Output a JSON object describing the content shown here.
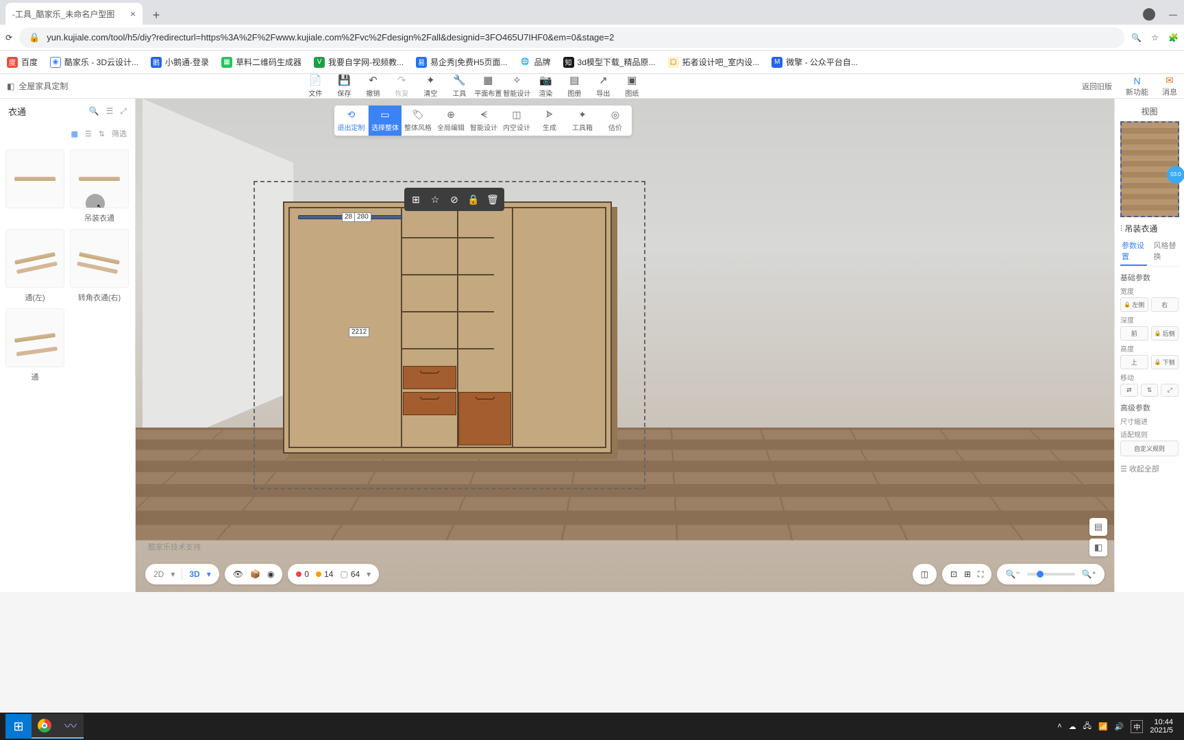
{
  "browser": {
    "tab_title": "-工具_酷家乐_未命名户型图",
    "url_display": "yun.kujiale.com/tool/h5/diy?redirecturl=https%3A%2F%2Fwww.kujiale.com%2Fvc%2Fdesign%2Fall&designid=3FO465U7IHF0&em=0&stage=2"
  },
  "bookmarks": [
    "百度",
    "酷家乐 - 3D云设计...",
    "小鹅通-登录",
    "草料二维码生成器",
    "我要自学网-视频教...",
    "易企秀|免费H5页面...",
    "品牌",
    "3d模型下载_精品原...",
    "拓者设计吧_室内设...",
    "微擎 - 公众平台自..."
  ],
  "app": {
    "mode_label": "全屋家具定制",
    "toolbar": [
      {
        "name": "file",
        "label": "文件",
        "icon": "📄"
      },
      {
        "name": "save",
        "label": "保存",
        "icon": "💾"
      },
      {
        "name": "undo",
        "label": "撤销",
        "icon": "↶"
      },
      {
        "name": "redo",
        "label": "恢复",
        "icon": "↷",
        "disabled": true
      },
      {
        "name": "clear",
        "label": "清空",
        "icon": "✦"
      },
      {
        "name": "tool",
        "label": "工具",
        "icon": "🔧"
      },
      {
        "name": "plan",
        "label": "平面布置",
        "icon": "▦"
      },
      {
        "name": "smart",
        "label": "智能设计",
        "icon": "✧"
      },
      {
        "name": "render",
        "label": "渲染",
        "icon": "📷"
      },
      {
        "name": "album",
        "label": "图册",
        "icon": "▤"
      },
      {
        "name": "export",
        "label": "导出",
        "icon": "↗"
      },
      {
        "name": "drawing",
        "label": "图纸",
        "icon": "▣"
      }
    ],
    "toolbar_right": {
      "oldver": "返回旧版",
      "new_feature": "新功能",
      "msg": "消息"
    },
    "sub_toolbar": [
      {
        "name": "exit",
        "label": "退出定制",
        "icon": "⟲",
        "cls": "primary"
      },
      {
        "name": "select",
        "label": "选择整体",
        "icon": "▭",
        "cls": "active"
      },
      {
        "name": "style",
        "label": "整体风格",
        "icon": "🏷",
        "cls": ""
      },
      {
        "name": "global-edit",
        "label": "全局编辑",
        "icon": "⊕",
        "cls": ""
      },
      {
        "name": "smart2",
        "label": "智能设计",
        "icon": "ᗕ",
        "cls": ""
      },
      {
        "name": "interior",
        "label": "内空设计",
        "icon": "◫",
        "cls": ""
      },
      {
        "name": "gen",
        "label": "生成",
        "icon": "ᗎ",
        "cls": ""
      },
      {
        "name": "toolbox",
        "label": "工具箱",
        "icon": "✦",
        "cls": ""
      },
      {
        "name": "cost",
        "label": "估价",
        "icon": "◎",
        "cls": ""
      }
    ]
  },
  "sidebar": {
    "title": "衣通",
    "filter_label": "筛选",
    "assets": [
      {
        "name": "hanging-rod-1",
        "label": ""
      },
      {
        "name": "hanging-rod-2",
        "label": "吊装衣通"
      },
      {
        "name": "corner-rod-left",
        "label": "通(左)"
      },
      {
        "name": "corner-rod-right",
        "label": "转角衣通(右)"
      },
      {
        "name": "rod-5",
        "label": "通"
      }
    ]
  },
  "canvas": {
    "ctx_actions": [
      "add",
      "favorite",
      "hide",
      "lock",
      "delete"
    ],
    "dimensions": {
      "d1": "28",
      "d2": "280",
      "d3": "2212"
    },
    "watermark": "酷家乐技术支持"
  },
  "status": {
    "mode2d": "2D",
    "mode3d": "3D",
    "alert_count": "0",
    "warn_count": "14",
    "info_count": "64"
  },
  "right_panel": {
    "view_title": "视图",
    "minimap_time": "03:0",
    "item_name": "吊装衣通",
    "tabs": [
      "参数设置",
      "风格替换"
    ],
    "section_basic": "基础参数",
    "width_label": "宽度",
    "width_btns": [
      "左侧",
      "右"
    ],
    "depth_label": "深度",
    "depth_btns": [
      "前",
      "后侧"
    ],
    "height_label": "高度",
    "height_btns": [
      "上",
      "下侧"
    ],
    "move_label": "移动",
    "section_adv": "高级参数",
    "scale_label": "尺寸缩进",
    "rule_label": "适配规则",
    "rule_value": "自定义规则",
    "collapse": "收起全部"
  },
  "taskbar": {
    "ime": "中",
    "time": "10:44",
    "date": "2021/5"
  }
}
